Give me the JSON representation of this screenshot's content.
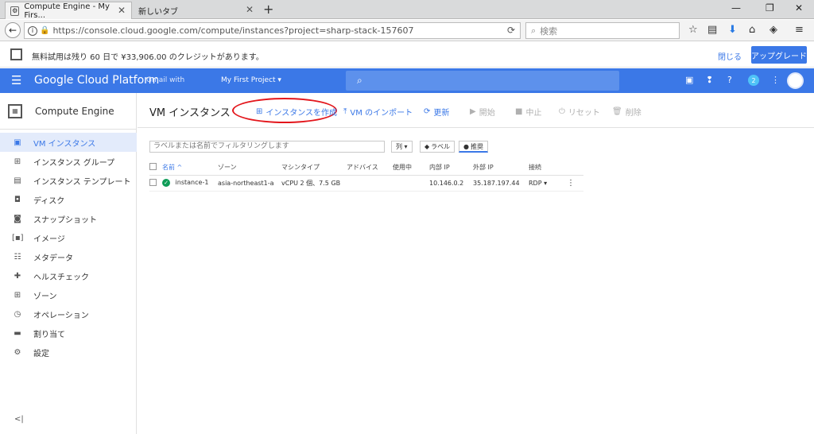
{
  "browser": {
    "tabs": [
      {
        "title": "Compute Engine - My Firs..."
      },
      {
        "title": "新しいタブ"
      }
    ],
    "url": "https://console.cloud.google.com/compute/instances?project=sharp-stack-157607",
    "search_placeholder": "検索"
  },
  "promo": {
    "message": "無料試用は残り 60 日で ¥33,906.00 のクレジットがあります。",
    "close_label": "閉じる",
    "upgrade_label": "アップグレード"
  },
  "header": {
    "brand": "Google Cloud Platform",
    "account": "Gmail with",
    "project": "My First Project ▾",
    "notification_count": "2"
  },
  "sidebar": {
    "product": "Compute Engine",
    "items": [
      {
        "label": "VM インスタンス",
        "icon": "vm-icon"
      },
      {
        "label": "インスタンス グループ",
        "icon": "group-icon"
      },
      {
        "label": "インスタンス テンプレート",
        "icon": "template-icon"
      },
      {
        "label": "ディスク",
        "icon": "disk-icon"
      },
      {
        "label": "スナップショット",
        "icon": "snapshot-icon"
      },
      {
        "label": "イメージ",
        "icon": "image-icon"
      },
      {
        "label": "メタデータ",
        "icon": "metadata-icon"
      },
      {
        "label": "ヘルスチェック",
        "icon": "health-icon"
      },
      {
        "label": "ゾーン",
        "icon": "zone-icon"
      },
      {
        "label": "オペレーション",
        "icon": "clock-icon"
      },
      {
        "label": "割り当て",
        "icon": "quota-icon"
      },
      {
        "label": "設定",
        "icon": "gear-icon"
      }
    ],
    "collapse": "<|"
  },
  "toolbar": {
    "title": "VM インスタンス",
    "create": "インスタンスを作成",
    "import": "VM のインポート",
    "refresh": "更新",
    "start": "開始",
    "stop": "中止",
    "reset": "リセット",
    "delete": "削除"
  },
  "filter": {
    "placeholder": "ラベルまたは名前でフィルタリングします",
    "columns": "列 ▾",
    "labels": "ラベル",
    "recommend": "推奨"
  },
  "table": {
    "headers": [
      "名前 ^",
      "ゾーン",
      "マシンタイプ",
      "アドバイス",
      "使用中",
      "内部 IP",
      "外部 IP",
      "接続"
    ],
    "rows": [
      {
        "name": "instance-1",
        "zone": "asia-northeast1-a",
        "machine": "vCPU 2 個、7.5 GB",
        "advice": "",
        "in_use": "",
        "internal_ip": "10.146.0.2",
        "external_ip": "35.187.197.44",
        "connect": "RDP ▾"
      }
    ]
  },
  "colors": {
    "accent": "#3b78e7",
    "annotation": "#e3161c",
    "running": "#0f9d58"
  }
}
